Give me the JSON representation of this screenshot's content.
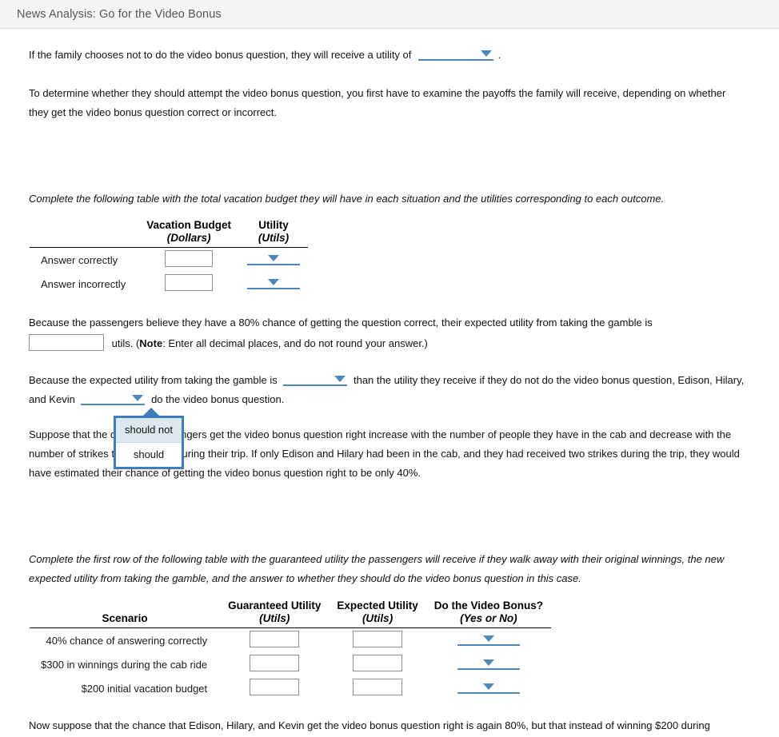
{
  "header": {
    "title": "News Analysis: Go for the Video Bonus"
  },
  "body": {
    "p1_before": "If the family chooses not to do the video bonus question, they will receive a utility of",
    "p1_after": ".",
    "p2": "To determine whether they should attempt the video bonus question, you first have to examine the payoffs the family will receive, depending on whether they get the video bonus question correct or incorrect.",
    "p3_instruction": "Complete the following table with the total vacation budget they will have in each situation and the utilities corresponding to each outcome.",
    "p4_before": "Because the passengers believe they have a 80% chance of getting the question correct, their expected utility from taking the gamble is",
    "p4_units": "utils. (",
    "p4_note_bold": "Note",
    "p4_note_rest": ": Enter all decimal places, and do not round your answer.)",
    "p5_a": "Because the expected utility from taking the gamble is",
    "p5_b": "than the utility they receive if they do not do the video bonus question, Edison, Hilary, and Kevin",
    "p5_c": "do the video bonus question.",
    "p6": "Suppose that the odds the passengers get the video bonus question right increase with the number of people they have in the cab and decrease with the number of strikes they received during their trip. If only Edison and Hilary had been in the cab, and they had received two strikes during the trip, they would have estimated their chance of getting the video bonus question right to be only 40%.",
    "p7_instruction": "Complete the first row of the following table with the guaranteed utility the passengers will receive if they walk away with their original winnings, the new expected utility from taking the gamble, and the answer to whether they should do the video bonus question in this case.",
    "p8": "Now suppose that the chance that Edison, Hilary, and Kevin get the video bonus question right is again 80%, but that instead of winning $200 during"
  },
  "table1": {
    "headers": [
      {
        "main": "",
        "sub": ""
      },
      {
        "main": "Vacation Budget",
        "sub": "(Dollars)"
      },
      {
        "main": "Utility",
        "sub": "(Utils)"
      }
    ],
    "rows": [
      {
        "label": "Answer correctly",
        "budget": "",
        "utility": ""
      },
      {
        "label": "Answer incorrectly",
        "budget": "",
        "utility": ""
      }
    ]
  },
  "table2": {
    "headers": [
      {
        "main": "",
        "sub": "Scenario"
      },
      {
        "main": "Guaranteed Utility",
        "sub": "(Utils)"
      },
      {
        "main": "Expected Utility",
        "sub": "(Utils)"
      },
      {
        "main": "Do the Video Bonus?",
        "sub": "(Yes or No)"
      }
    ],
    "rows": [
      {
        "label": "40% chance of answering correctly",
        "guaranteed": "",
        "expected": "",
        "bonus": ""
      },
      {
        "label": "$300 in winnings during the cab ride",
        "guaranteed": "",
        "expected": "",
        "bonus": ""
      },
      {
        "label": "$200 initial vacation budget",
        "guaranteed": "",
        "expected": "",
        "bonus": ""
      }
    ]
  },
  "dropdown_popup": {
    "options": [
      {
        "label": "should not",
        "hovered": true
      },
      {
        "label": "should",
        "hovered": false
      }
    ]
  },
  "colors": {
    "accent_blue": "#4a87bd",
    "popup_border": "#3d7fbc",
    "popup_hover_bg": "#dde7ee",
    "header_bg": "#f5f5f5",
    "title_text": "#555555"
  },
  "inputs": {
    "utility_dropdown_value": "",
    "expected_utility_value": "",
    "comparison_dropdown_value": "",
    "decision_dropdown_value": ""
  }
}
